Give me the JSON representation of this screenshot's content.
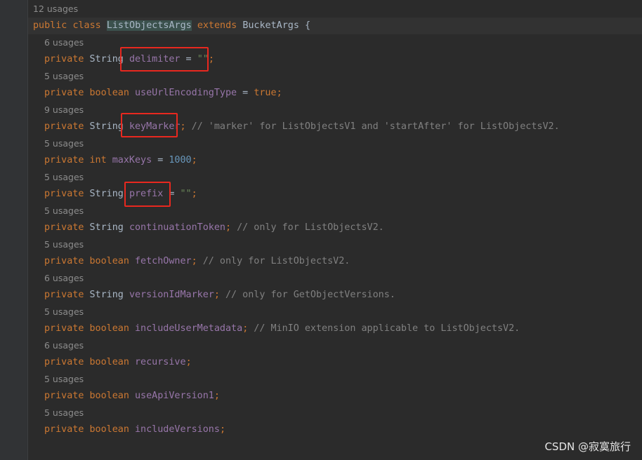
{
  "class_usage": "12 usages",
  "class_decl": {
    "kw1": "public",
    "kw2": "class",
    "name": "ListObjectsArgs",
    "kw3": "extends",
    "parent": "BucketArgs",
    "brace": " {"
  },
  "fields": [
    {
      "usage": "6 usages",
      "mod": "private",
      "type": "String",
      "name": "delimiter",
      "init_op": " = ",
      "init": "\"\"",
      "init_kind": "str",
      "semi": ";",
      "comment": ""
    },
    {
      "usage": "5 usages",
      "mod": "private",
      "type": "boolean",
      "name": "useUrlEncodingType",
      "init_op": " = ",
      "init": "true",
      "init_kind": "kw",
      "semi": ";",
      "comment": ""
    },
    {
      "usage": "9 usages",
      "mod": "private",
      "type": "String",
      "name": "keyMarker",
      "init_op": "",
      "init": "",
      "init_kind": "",
      "semi": ";",
      "comment": " // 'marker' for ListObjectsV1 and 'startAfter' for ListObjectsV2."
    },
    {
      "usage": "5 usages",
      "mod": "private",
      "type": "int",
      "name": "maxKeys",
      "init_op": " = ",
      "init": "1000",
      "init_kind": "num",
      "semi": ";",
      "comment": ""
    },
    {
      "usage": "5 usages",
      "mod": "private",
      "type": "String",
      "name": "prefix",
      "init_op": " = ",
      "init": "\"\"",
      "init_kind": "str",
      "semi": ";",
      "comment": ""
    },
    {
      "usage": "5 usages",
      "mod": "private",
      "type": "String",
      "name": "continuationToken",
      "init_op": "",
      "init": "",
      "init_kind": "",
      "semi": ";",
      "comment": " // only for ListObjectsV2."
    },
    {
      "usage": "5 usages",
      "mod": "private",
      "type": "boolean",
      "name": "fetchOwner",
      "init_op": "",
      "init": "",
      "init_kind": "",
      "semi": ";",
      "comment": " // only for ListObjectsV2."
    },
    {
      "usage": "6 usages",
      "mod": "private",
      "type": "String",
      "name": "versionIdMarker",
      "init_op": "",
      "init": "",
      "init_kind": "",
      "semi": ";",
      "comment": " // only for GetObjectVersions."
    },
    {
      "usage": "5 usages",
      "mod": "private",
      "type": "boolean",
      "name": "includeUserMetadata",
      "init_op": "",
      "init": "",
      "init_kind": "",
      "semi": ";",
      "comment": " // MinIO extension applicable to ListObjectsV2."
    },
    {
      "usage": "6 usages",
      "mod": "private",
      "type": "boolean",
      "name": "recursive",
      "init_op": "",
      "init": "",
      "init_kind": "",
      "semi": ";",
      "comment": ""
    },
    {
      "usage": "5 usages",
      "mod": "private",
      "type": "boolean",
      "name": "useApiVersion1",
      "init_op": "",
      "init": "",
      "init_kind": "",
      "semi": ";",
      "comment": ""
    },
    {
      "usage": "5 usages",
      "mod": "private",
      "type": "boolean",
      "name": "includeVersions",
      "init_op": "",
      "init": "",
      "init_kind": "",
      "semi": ";",
      "comment": ""
    }
  ],
  "watermark": "CSDN @寂寞旅行",
  "colors": {
    "background": "#2b2b2b",
    "keyword": "#cc7832",
    "field": "#9876aa",
    "string": "#6a8759",
    "number": "#6897bb",
    "comment": "#808080",
    "highlight_box": "#e8281f"
  }
}
